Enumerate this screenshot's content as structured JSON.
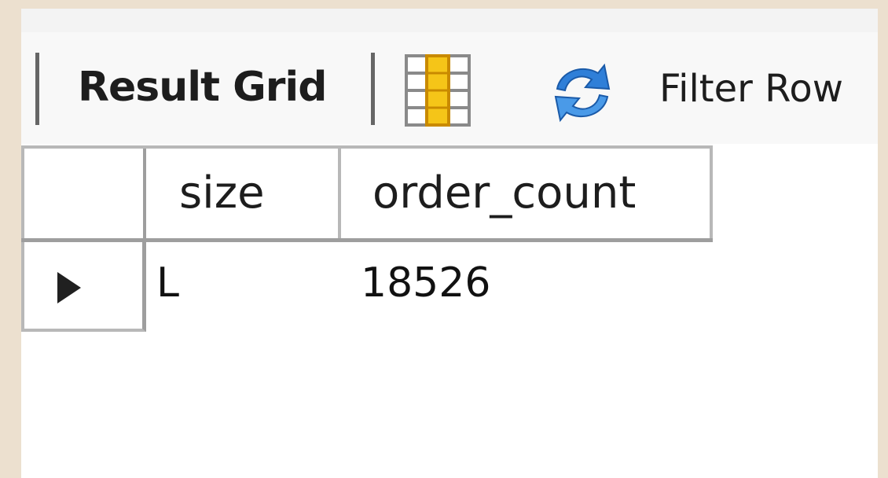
{
  "toolbar": {
    "result_grid_label": "Result Grid",
    "filter_rows_label": "Filter Row",
    "grid_icon": "result-grid-layout-icon",
    "refresh_icon": "refresh-icon"
  },
  "grid": {
    "columns": [
      "size",
      "order_count"
    ],
    "rows": [
      {
        "size": "L",
        "order_count": "18526"
      }
    ]
  },
  "colors": {
    "outer_background": "#ece0cf",
    "toolbar_background": "#f8f8f8",
    "grid_border": "#b8b8b8",
    "icon_yellow": "#f5c518",
    "icon_blue": "#2f7fd8"
  }
}
